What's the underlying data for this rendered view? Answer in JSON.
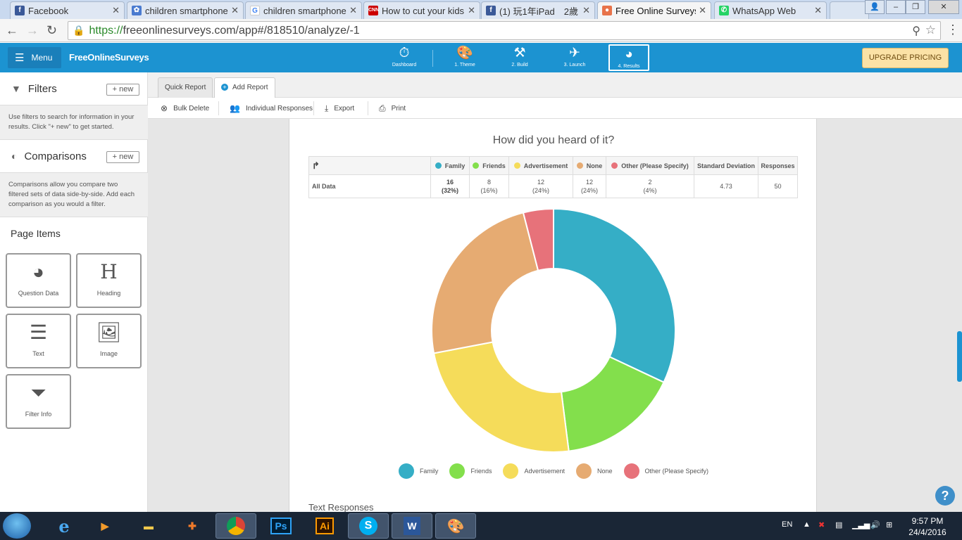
{
  "browser": {
    "tabs": [
      {
        "title": "Facebook",
        "favicon": "facebook-icon",
        "color": "#3b5998"
      },
      {
        "title": "children smartphone",
        "favicon": "flickr-like-icon",
        "color": "#4a7bd0"
      },
      {
        "title": "children smartphone",
        "favicon": "google-icon",
        "color": "#4285f4"
      },
      {
        "title": "How to cut your kids",
        "favicon": "cnn-icon",
        "color": "#cc0000"
      },
      {
        "title": "(1) 玩1年iPad　2歲",
        "favicon": "facebook-icon",
        "color": "#3b5998"
      },
      {
        "title": "Free Online Surveys",
        "favicon": "freeonlinesurveys-icon",
        "color": "#e8734a"
      },
      {
        "title": "WhatsApp Web",
        "favicon": "whatsapp-icon",
        "color": "#25d366"
      }
    ],
    "active_tab": 5,
    "url_scheme": "https://",
    "url_rest": "freeonlinesurveys.com/app#/818510/analyze/-1"
  },
  "header": {
    "menu_label": "Menu",
    "logo": "FreeOnlineSurveys",
    "steps": [
      {
        "label": "Dashboard",
        "icon": "dashboard-icon"
      },
      {
        "label": "1. Theme",
        "icon": "palette-icon"
      },
      {
        "label": "2. Build",
        "icon": "hammer-icon"
      },
      {
        "label": "3. Launch",
        "icon": "plane-icon"
      },
      {
        "label": "4. Results",
        "icon": "pie-chart-icon"
      }
    ],
    "active_step": 4,
    "upgrade_label": "UPGRADE PRICING"
  },
  "sidebar": {
    "filters": {
      "title": "Filters",
      "new_label": "+ new",
      "description": "Use filters to search for information in your results. Click \"+ new\" to get started."
    },
    "comparisons": {
      "title": "Comparisons",
      "new_label": "+ new",
      "description": "Comparisons allow you compare two filtered sets of data side-by-side. Add each comparison as you would a filter."
    },
    "page_items_title": "Page Items",
    "page_items": [
      {
        "label": "Question Data",
        "icon": "pie-chart-icon"
      },
      {
        "label": "Heading",
        "icon": "heading-icon"
      },
      {
        "label": "Text",
        "icon": "text-lines-icon"
      },
      {
        "label": "Image",
        "icon": "image-icon"
      },
      {
        "label": "Filter Info",
        "icon": "filter-icon"
      }
    ]
  },
  "report_tabs": {
    "quick_report": "Quick Report",
    "add_report": "Add Report"
  },
  "actions": {
    "bulk_delete": "Bulk Delete",
    "individual_responses": "Individual Responses",
    "export": "Export",
    "print": "Print"
  },
  "question": {
    "title": "How did you heard of it?",
    "table": {
      "headers": [
        "Family",
        "Friends",
        "Advertisement",
        "None",
        "Other (Please Specify)",
        "Standard Deviation",
        "Responses"
      ],
      "row_label": "All Data",
      "counts": [
        "16",
        "8",
        "12",
        "12",
        "2"
      ],
      "percents": [
        "(32%)",
        "(16%)",
        "(24%)",
        "(24%)",
        "(4%)"
      ],
      "std_dev": "4.73",
      "responses": "50"
    }
  },
  "chart_data": {
    "type": "pie",
    "donut": true,
    "categories": [
      "Family",
      "Friends",
      "Advertisement",
      "None",
      "Other (Please Specify)"
    ],
    "values": [
      16,
      8,
      12,
      12,
      2
    ],
    "colors": [
      "#35aec6",
      "#83df4c",
      "#f5dc5a",
      "#e6ab72",
      "#e7727a"
    ],
    "legend_position": "bottom"
  },
  "text_responses_title": "Text Responses",
  "taskbar": {
    "items": [
      "ie-icon",
      "media-player-icon",
      "file-explorer-icon",
      "app-store-icon",
      "chrome-icon",
      "photoshop-icon",
      "illustrator-icon",
      "skype-icon",
      "word-icon",
      "paint-icon"
    ],
    "photoshop_label": "Ps",
    "illustrator_label": "Ai",
    "language": "EN",
    "time": "9:57 PM",
    "date": "24/4/2016"
  }
}
